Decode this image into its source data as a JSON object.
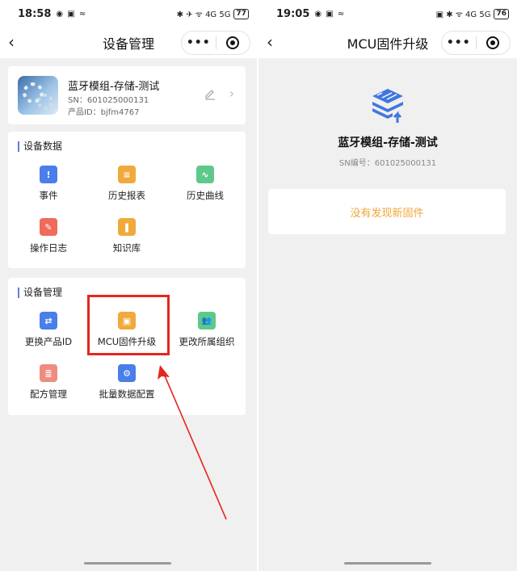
{
  "left_screen": {
    "status": {
      "time": "18:58",
      "sys_icons": "◉ ▣ ≈",
      "right_icons": "✱ ✈ ᯤ 4G 5G",
      "battery": "77"
    },
    "nav": {
      "back": "‹",
      "title": "设备管理",
      "more": "•••"
    },
    "device": {
      "name": "蓝牙模组-存储-测试",
      "sn": "SN：601025000131",
      "product_id": "产品ID：bjfm4767"
    },
    "section_data": {
      "title": "设备数据",
      "items": [
        {
          "label": "事件",
          "icon": "event-icon",
          "glyph": "!"
        },
        {
          "label": "历史报表",
          "icon": "report-icon",
          "glyph": "≡"
        },
        {
          "label": "历史曲线",
          "icon": "curve-icon",
          "glyph": "∿"
        },
        {
          "label": "操作日志",
          "icon": "log-icon",
          "glyph": "✎"
        },
        {
          "label": "知识库",
          "icon": "knowledge-icon",
          "glyph": "❚"
        }
      ]
    },
    "section_manage": {
      "title": "设备管理",
      "items": [
        {
          "label": "更换产品ID",
          "icon": "swap-icon",
          "glyph": "⇄"
        },
        {
          "label": "MCU固件升级",
          "icon": "chip-icon",
          "glyph": "▣"
        },
        {
          "label": "更改所属组织",
          "icon": "group-icon",
          "glyph": "👥"
        },
        {
          "label": "配方管理",
          "icon": "recipe-icon",
          "glyph": "≣"
        },
        {
          "label": "批量数据配置",
          "icon": "batch-config-icon",
          "glyph": "⚙"
        }
      ]
    }
  },
  "right_screen": {
    "status": {
      "time": "19:05",
      "sys_icons": "◉ ▣ ≈",
      "right_icons": "▣ ✱ ᯤ 4G 5G",
      "battery": "76"
    },
    "nav": {
      "back": "‹",
      "title": "MCU固件升级",
      "more": "•••"
    },
    "device_name": "蓝牙模组-存储-测试",
    "sn": "SN编号：601025000131",
    "message": "没有发现新固件"
  },
  "colors": {
    "accent_blue": "#4a7ee8",
    "highlight_red": "#e5261e",
    "message_orange": "#f0a63a"
  }
}
